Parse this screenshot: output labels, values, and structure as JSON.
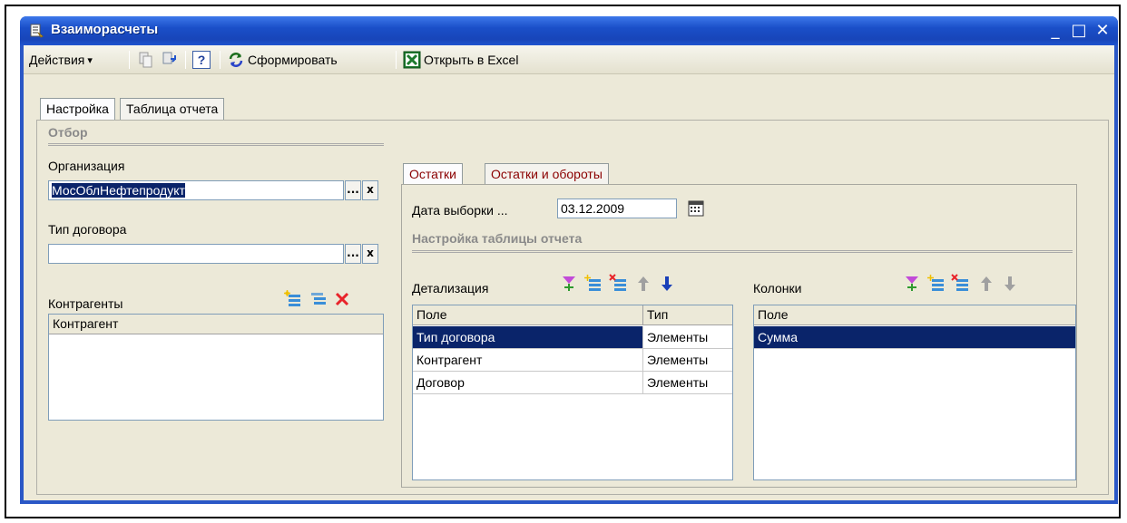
{
  "window": {
    "title": "Взаиморасчеты",
    "minimize_glyph": "_",
    "maximize_glyph": "□",
    "close_glyph": "✕"
  },
  "toolbar": {
    "actions_label": "Действия",
    "actions_arrow": "▾",
    "help_glyph": "?",
    "generate_label": "Сформировать",
    "excel_label": "Открыть в Excel"
  },
  "main_tabs": [
    {
      "label": "Настройка",
      "active": true
    },
    {
      "label": "Таблица отчета",
      "active": false
    }
  ],
  "filter": {
    "section_title": "Отбор",
    "organization_label": "Организация",
    "organization_value": "МосОблНефтепродукт",
    "contract_type_label": "Тип договора",
    "contract_type_value": "",
    "ellipsis": "...",
    "clear_glyph": "x",
    "counterparties_label": "Контрагенты",
    "counterparties_header": "Контрагент"
  },
  "sub_tabs": [
    {
      "label": "Остатки",
      "active": true
    },
    {
      "label": "Остатки и обороты",
      "active": false
    }
  ],
  "settings": {
    "date_label": "Дата выборки ...",
    "date_value": "03.12.2009",
    "table_settings_title": "Настройка таблицы отчета",
    "detail_label": "Детализация",
    "detail_headers": [
      "Поле",
      "Тип"
    ],
    "detail_rows": [
      {
        "field": "Тип договора",
        "type": "Элементы",
        "selected": true
      },
      {
        "field": "Контрагент",
        "type": "Элементы",
        "selected": false
      },
      {
        "field": "Договор",
        "type": "Элементы",
        "selected": false
      }
    ],
    "columns_label": "Колонки",
    "columns_header": "Поле",
    "columns_rows": [
      {
        "field": "Сумма",
        "selected": true
      }
    ]
  },
  "colors": {
    "title_bar": "#1a4fc8",
    "selection": "#0a246a",
    "tab_text_inactive": "#8b0000",
    "delete_red": "#e8232a"
  }
}
